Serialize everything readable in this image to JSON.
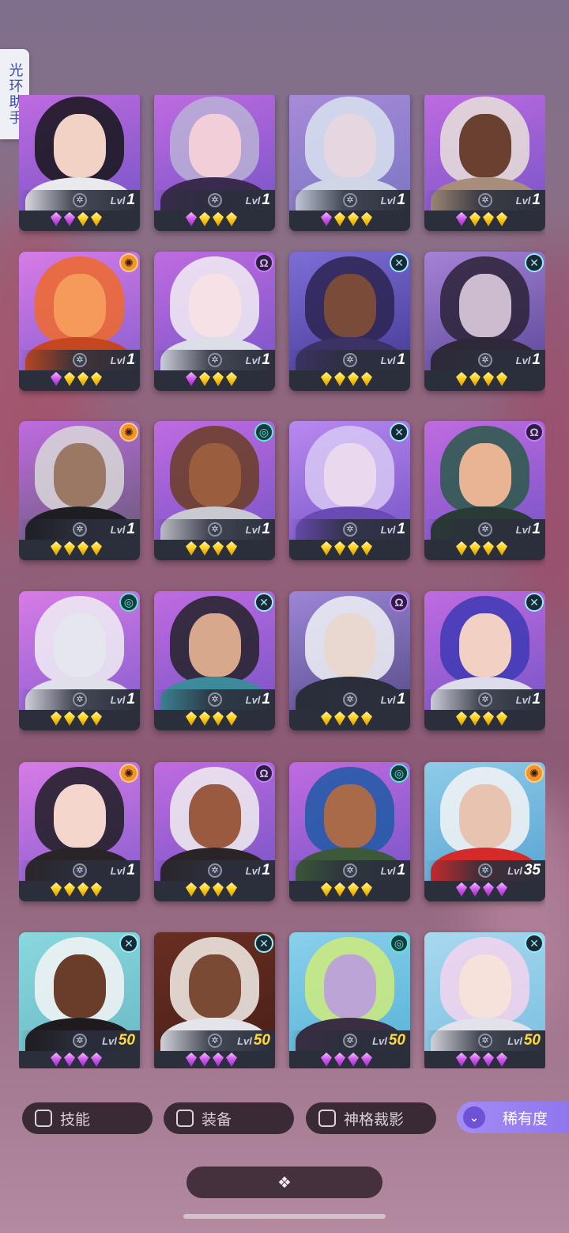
{
  "side_tab": {
    "label": "光环助手"
  },
  "cards": [
    {
      "lvl": "1",
      "lvl_color": "white",
      "gems": [
        "p",
        "p",
        "g",
        "g"
      ],
      "badge": "none",
      "bg": [
        "#c06be0",
        "#7a56c8"
      ],
      "hair": "#141418",
      "skin": "#f3d2c6",
      "shoulder": "#e9e9ee"
    },
    {
      "lvl": "1",
      "lvl_color": "white",
      "gems": [
        "p",
        "g",
        "g",
        "g"
      ],
      "badge": "none",
      "bg": [
        "#c06be0",
        "#7a56c8"
      ],
      "hair": "#b9b1d6",
      "skin": "#f2cfd8",
      "shoulder": "#3a2a4d"
    },
    {
      "lvl": "1",
      "lvl_color": "white",
      "gems": [
        "p",
        "g",
        "g",
        "g"
      ],
      "badge": "none",
      "bg": [
        "#a88bd8",
        "#7c76c4"
      ],
      "hair": "#d8e3f0",
      "skin": "#e6d6e0",
      "shoulder": "#cfd6e6"
    },
    {
      "lvl": "1",
      "lvl_color": "white",
      "gems": [
        "p",
        "g",
        "g",
        "g"
      ],
      "badge": "none",
      "bg": [
        "#c06be0",
        "#7a56c8"
      ],
      "hair": "#e8e2da",
      "skin": "#6a4030",
      "shoulder": "#a88e7a"
    },
    {
      "lvl": "1",
      "lvl_color": "white",
      "gems": [
        "p",
        "g",
        "g",
        "g"
      ],
      "badge": "orange",
      "bg": [
        "#d77be6",
        "#8a5fd0"
      ],
      "hair": "#ef6a2a",
      "skin": "#f59a5a",
      "shoulder": "#c4471f"
    },
    {
      "lvl": "1",
      "lvl_color": "white",
      "gems": [
        "p",
        "g",
        "g",
        "g"
      ],
      "badge": "purple",
      "bg": [
        "#c06be0",
        "#7a56c8"
      ],
      "hair": "#f2f0f4",
      "skin": "#f6e2e6",
      "shoulder": "#dcdfe8"
    },
    {
      "lvl": "1",
      "lvl_color": "white",
      "gems": [
        "g",
        "g",
        "g",
        "g"
      ],
      "badge": "cyan",
      "bg": [
        "#7d6ed6",
        "#473c98"
      ],
      "hair": "#2b2550",
      "skin": "#7a4b38",
      "shoulder": "#3c3266"
    },
    {
      "lvl": "1",
      "lvl_color": "white",
      "gems": [
        "g",
        "g",
        "g",
        "g"
      ],
      "badge": "cyan",
      "bg": [
        "#a682d6",
        "#5d4a9a"
      ],
      "hair": "#2a2236",
      "skin": "#cdbcd0",
      "shoulder": "#2e2838"
    },
    {
      "lvl": "1",
      "lvl_color": "white",
      "gems": [
        "g",
        "g",
        "g",
        "g"
      ],
      "badge": "orange",
      "bg": [
        "#c06be0",
        "#6a5c7c"
      ],
      "hair": "#d8d8d8",
      "skin": "#9a7864",
      "shoulder": "#1e1e22"
    },
    {
      "lvl": "1",
      "lvl_color": "white",
      "gems": [
        "g",
        "g",
        "g",
        "g"
      ],
      "badge": "teal",
      "bg": [
        "#c06be0",
        "#7a56c8"
      ],
      "hair": "#6a3d22",
      "skin": "#9a5e3e",
      "shoulder": "#c9c9d2"
    },
    {
      "lvl": "1",
      "lvl_color": "white",
      "gems": [
        "g",
        "g",
        "g",
        "g"
      ],
      "badge": "cyan",
      "bg": [
        "#b889f0",
        "#7a56c8"
      ],
      "hair": "#d6c8f4",
      "skin": "#e9d8ee",
      "shoulder": "#6a4bb6"
    },
    {
      "lvl": "1",
      "lvl_color": "white",
      "gems": [
        "g",
        "g",
        "g",
        "g"
      ],
      "badge": "purple",
      "bg": [
        "#c06be0",
        "#7a56c8"
      ],
      "hair": "#2a5a4a",
      "skin": "#e9b494",
      "shoulder": "#2a3a34"
    },
    {
      "lvl": "1",
      "lvl_color": "white",
      "gems": [
        "g",
        "g",
        "g",
        "g"
      ],
      "badge": "teal",
      "bg": [
        "#d77be6",
        "#8a5fd0"
      ],
      "hair": "#f0f0f4",
      "skin": "#e6e6ee",
      "shoulder": "#e0e0ea"
    },
    {
      "lvl": "1",
      "lvl_color": "white",
      "gems": [
        "g",
        "g",
        "g",
        "g"
      ],
      "badge": "cyan",
      "bg": [
        "#c06be0",
        "#7a56c8"
      ],
      "hair": "#222228",
      "skin": "#d8a88c",
      "shoulder": "#3c8a9a"
    },
    {
      "lvl": "1",
      "lvl_color": "white",
      "gems": [
        "g",
        "g",
        "g",
        "g"
      ],
      "badge": "purple",
      "bg": [
        "#9c86d6",
        "#5a4e8c"
      ],
      "hair": "#f0f2f6",
      "skin": "#e9d8d0",
      "shoulder": "#2a2e3a"
    },
    {
      "lvl": "1",
      "lvl_color": "white",
      "gems": [
        "g",
        "g",
        "g",
        "g"
      ],
      "badge": "cyan",
      "bg": [
        "#c06be0",
        "#7a56c8"
      ],
      "hair": "#3d39b4",
      "skin": "#f3d0c4",
      "shoulder": "#dcdcea"
    },
    {
      "lvl": "1",
      "lvl_color": "white",
      "gems": [
        "g",
        "g",
        "g",
        "g"
      ],
      "badge": "orange",
      "bg": [
        "#d77be6",
        "#8a5fd0"
      ],
      "hair": "#1c1c22",
      "skin": "#f5d6cc",
      "shoulder": "#2a2428"
    },
    {
      "lvl": "1",
      "lvl_color": "white",
      "gems": [
        "g",
        "g",
        "g",
        "g"
      ],
      "badge": "purple",
      "bg": [
        "#c06be0",
        "#7a56c8"
      ],
      "hair": "#f0f0f0",
      "skin": "#9a5a40",
      "shoulder": "#2a2428"
    },
    {
      "lvl": "1",
      "lvl_color": "white",
      "gems": [
        "g",
        "g",
        "g",
        "g"
      ],
      "badge": "teal",
      "bg": [
        "#c06be0",
        "#7a56c8"
      ],
      "hair": "#1f5aa6",
      "skin": "#a86a48",
      "shoulder": "#3c5a3a"
    },
    {
      "lvl": "35",
      "lvl_color": "white",
      "gems": [
        "p",
        "p",
        "p",
        "p"
      ],
      "badge": "orange",
      "bg": [
        "#8fcbe8",
        "#5aa6d4"
      ],
      "hair": "#f4f4f6",
      "skin": "#e8c4b0",
      "shoulder": "#d42a2a"
    },
    {
      "lvl": "50",
      "lvl_color": "yellow",
      "gems": [
        "p",
        "p",
        "p",
        "p"
      ],
      "badge": "cyan",
      "bg": [
        "#8ad8de",
        "#6bbac6"
      ],
      "hair": "#f4f4f6",
      "skin": "#6a3c2a",
      "shoulder": "#1e1a1e"
    },
    {
      "lvl": "50",
      "lvl_color": "yellow",
      "gems": [
        "p",
        "p",
        "p",
        "p"
      ],
      "badge": "cyan",
      "bg": [
        "#6a2e22",
        "#4a2018"
      ],
      "hair": "#f4f0ea",
      "skin": "#7a4a34",
      "shoulder": "#e4e4ea"
    },
    {
      "lvl": "50",
      "lvl_color": "yellow",
      "gems": [
        "p",
        "p",
        "p",
        "p"
      ],
      "badge": "teal",
      "bg": [
        "#8ad0ec",
        "#5ab4d8"
      ],
      "hair": "#cfeb7a",
      "skin": "#bda4d6",
      "shoulder": "#3a2e44"
    },
    {
      "lvl": "50",
      "lvl_color": "yellow",
      "gems": [
        "p",
        "p",
        "p",
        "p"
      ],
      "badge": "cyan",
      "bg": [
        "#a9d8f0",
        "#7bc1e0"
      ],
      "hair": "#f4d4ee",
      "skin": "#f6e2da",
      "shoulder": "#e2e2ea"
    }
  ],
  "filters": {
    "skills_label": "技能",
    "equipment_label": "装备",
    "divine_label": "神格裁影",
    "rarity_label": "稀有度"
  },
  "lvl_prefix": "Lvl",
  "bottom_button_icon": "diamond-cluster-icon"
}
